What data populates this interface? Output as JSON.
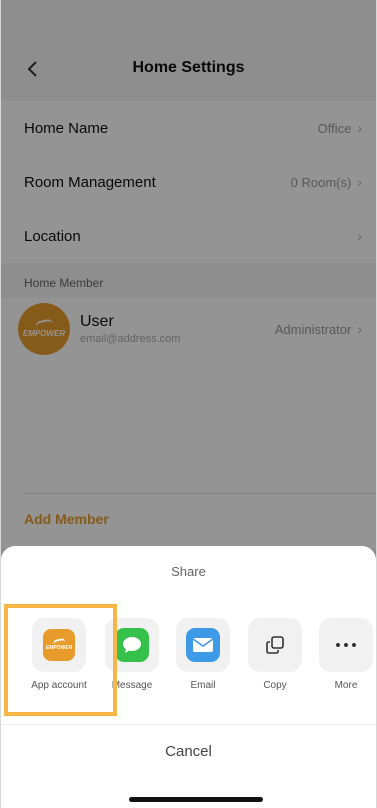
{
  "header": {
    "title": "Home Settings"
  },
  "settings": [
    {
      "label": "Home Name",
      "value": "Office"
    },
    {
      "label": "Room Management",
      "value": "0 Room(s)"
    },
    {
      "label": "Location",
      "value": ""
    }
  ],
  "members": {
    "section_label": "Home Member",
    "user": {
      "name": "User",
      "email": "email@address.com",
      "role": "Administrator",
      "avatar_brand": "EMPOWER"
    }
  },
  "add_member_label": "Add Member",
  "share_sheet": {
    "title": "Share",
    "items": [
      {
        "label": "App account",
        "icon": "empower-app-icon",
        "brand": "EMPOWER"
      },
      {
        "label": "Message",
        "icon": "message-icon"
      },
      {
        "label": "Email",
        "icon": "email-icon"
      },
      {
        "label": "Copy",
        "icon": "copy-icon"
      },
      {
        "label": "More",
        "icon": "more-icon"
      }
    ],
    "cancel_label": "Cancel"
  },
  "colors": {
    "accent": "#e79b2b",
    "highlight": "#f7b547",
    "message": "#36c24a",
    "email": "#3d9ae8"
  }
}
